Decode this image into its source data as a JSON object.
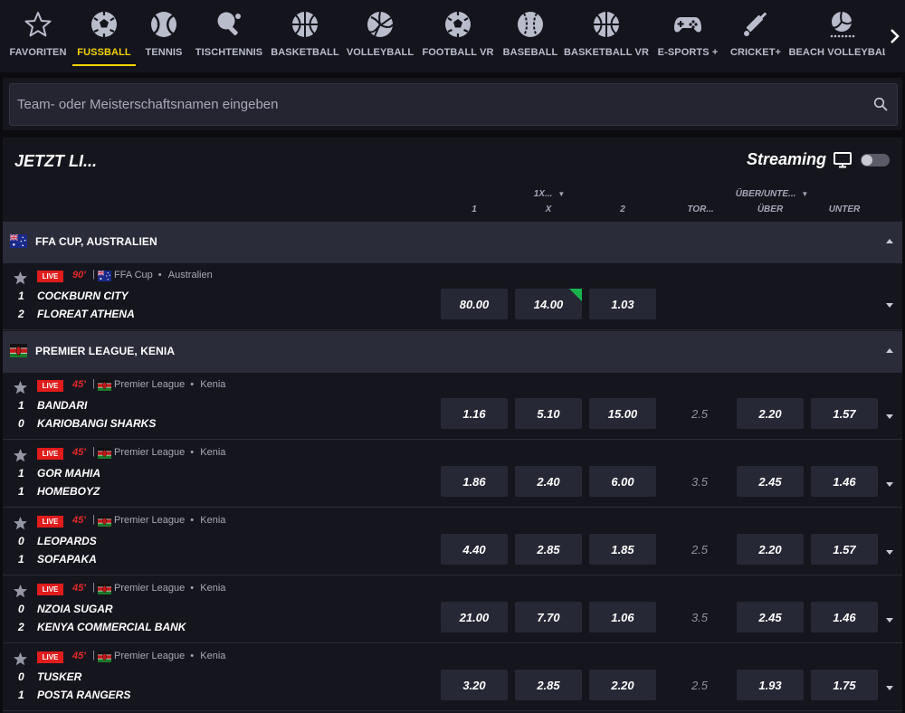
{
  "sports_nav": {
    "items": [
      {
        "label": "FAVORITEN",
        "icon": "star-icon",
        "active": false
      },
      {
        "label": "FUSSBALL",
        "icon": "soccer-ball-icon",
        "active": true
      },
      {
        "label": "TENNIS",
        "icon": "tennis-ball-icon",
        "active": false
      },
      {
        "label": "TISCHTENNIS",
        "icon": "table-tennis-icon",
        "active": false
      },
      {
        "label": "BASKETBALL",
        "icon": "basketball-icon",
        "active": false
      },
      {
        "label": "VOLLEYBALL",
        "icon": "volleyball-icon",
        "active": false
      },
      {
        "label": "FOOTBALL VR",
        "icon": "soccer-ball-icon",
        "active": false
      },
      {
        "label": "BASEBALL",
        "icon": "baseball-icon",
        "active": false
      },
      {
        "label": "BASKETBALL VR",
        "icon": "basketball-icon",
        "active": false
      },
      {
        "label": "E-SPORTS +",
        "icon": "gamepad-icon",
        "active": false
      },
      {
        "label": "CRICKET+",
        "icon": "cricket-bat-icon",
        "active": false
      },
      {
        "label": "BEACH VOLLEYBALL",
        "icon": "beach-volleyball-icon",
        "active": false
      }
    ],
    "next_arrow_icon": "chevron-right-icon",
    "active_color": "#f3d400"
  },
  "search": {
    "placeholder": "Team- oder Meisterschaftsnamen eingeben",
    "value": ""
  },
  "live": {
    "title": "JETZT LI...",
    "streaming_label": "Streaming",
    "streaming_enabled": false
  },
  "columns": {
    "market1": "1X...",
    "market2": "ÜBER/UNTE...",
    "c1": "1",
    "cx": "X",
    "c2": "2",
    "goals": "TOR...",
    "over": "ÜBER",
    "under": "UNTER"
  },
  "leagues": [
    {
      "name": "FFA CUP, AUSTRALIEN",
      "flag": "australia",
      "matches": [
        {
          "live": "LIVE",
          "minute": "90'",
          "competition": "FFA Cup",
          "region": "Australien",
          "home_score": "1",
          "home": "COCKBURN CITY",
          "away_score": "2",
          "away": "FLOREAT ATHENA",
          "odds": [
            "80.00",
            "14.00",
            "1.03"
          ],
          "odds_changed": [
            false,
            true,
            false
          ],
          "total": "",
          "over": "",
          "under": ""
        }
      ]
    },
    {
      "name": "PREMIER LEAGUE, KENIA",
      "flag": "kenya",
      "matches": [
        {
          "live": "LIVE",
          "minute": "45'",
          "competition": "Premier League",
          "region": "Kenia",
          "home_score": "1",
          "home": "BANDARI",
          "away_score": "0",
          "away": "KARIOBANGI SHARKS",
          "odds": [
            "1.16",
            "5.10",
            "15.00"
          ],
          "odds_changed": [
            false,
            false,
            false
          ],
          "total": "2.5",
          "over": "2.20",
          "under": "1.57"
        },
        {
          "live": "LIVE",
          "minute": "45'",
          "competition": "Premier League",
          "region": "Kenia",
          "home_score": "1",
          "home": "GOR MAHIA",
          "away_score": "1",
          "away": "HOMEBOYZ",
          "odds": [
            "1.86",
            "2.40",
            "6.00"
          ],
          "odds_changed": [
            false,
            false,
            false
          ],
          "total": "3.5",
          "over": "2.45",
          "under": "1.46"
        },
        {
          "live": "LIVE",
          "minute": "45'",
          "competition": "Premier League",
          "region": "Kenia",
          "home_score": "0",
          "home": "LEOPARDS",
          "away_score": "1",
          "away": "SOFAPAKA",
          "odds": [
            "4.40",
            "2.85",
            "1.85"
          ],
          "odds_changed": [
            false,
            false,
            false
          ],
          "total": "2.5",
          "over": "2.20",
          "under": "1.57"
        },
        {
          "live": "LIVE",
          "minute": "45'",
          "competition": "Premier League",
          "region": "Kenia",
          "home_score": "0",
          "home": "NZOIA SUGAR",
          "away_score": "2",
          "away": "KENYA COMMERCIAL BANK",
          "odds": [
            "21.00",
            "7.70",
            "1.06"
          ],
          "odds_changed": [
            false,
            false,
            false
          ],
          "total": "3.5",
          "over": "2.45",
          "under": "1.46"
        },
        {
          "live": "LIVE",
          "minute": "45'",
          "competition": "Premier League",
          "region": "Kenia",
          "home_score": "0",
          "home": "TUSKER",
          "away_score": "1",
          "away": "POSTA RANGERS",
          "odds": [
            "3.20",
            "2.85",
            "2.20"
          ],
          "odds_changed": [
            false,
            false,
            false
          ],
          "total": "2.5",
          "over": "1.93",
          "under": "1.75"
        }
      ]
    }
  ],
  "colors": {
    "background": "#0b0b10",
    "panel": "#15151d",
    "league_header": "#2b2c3a",
    "odd_button": "#272835",
    "live_red": "#e01c1c",
    "odd_up_green": "#19b34e"
  }
}
